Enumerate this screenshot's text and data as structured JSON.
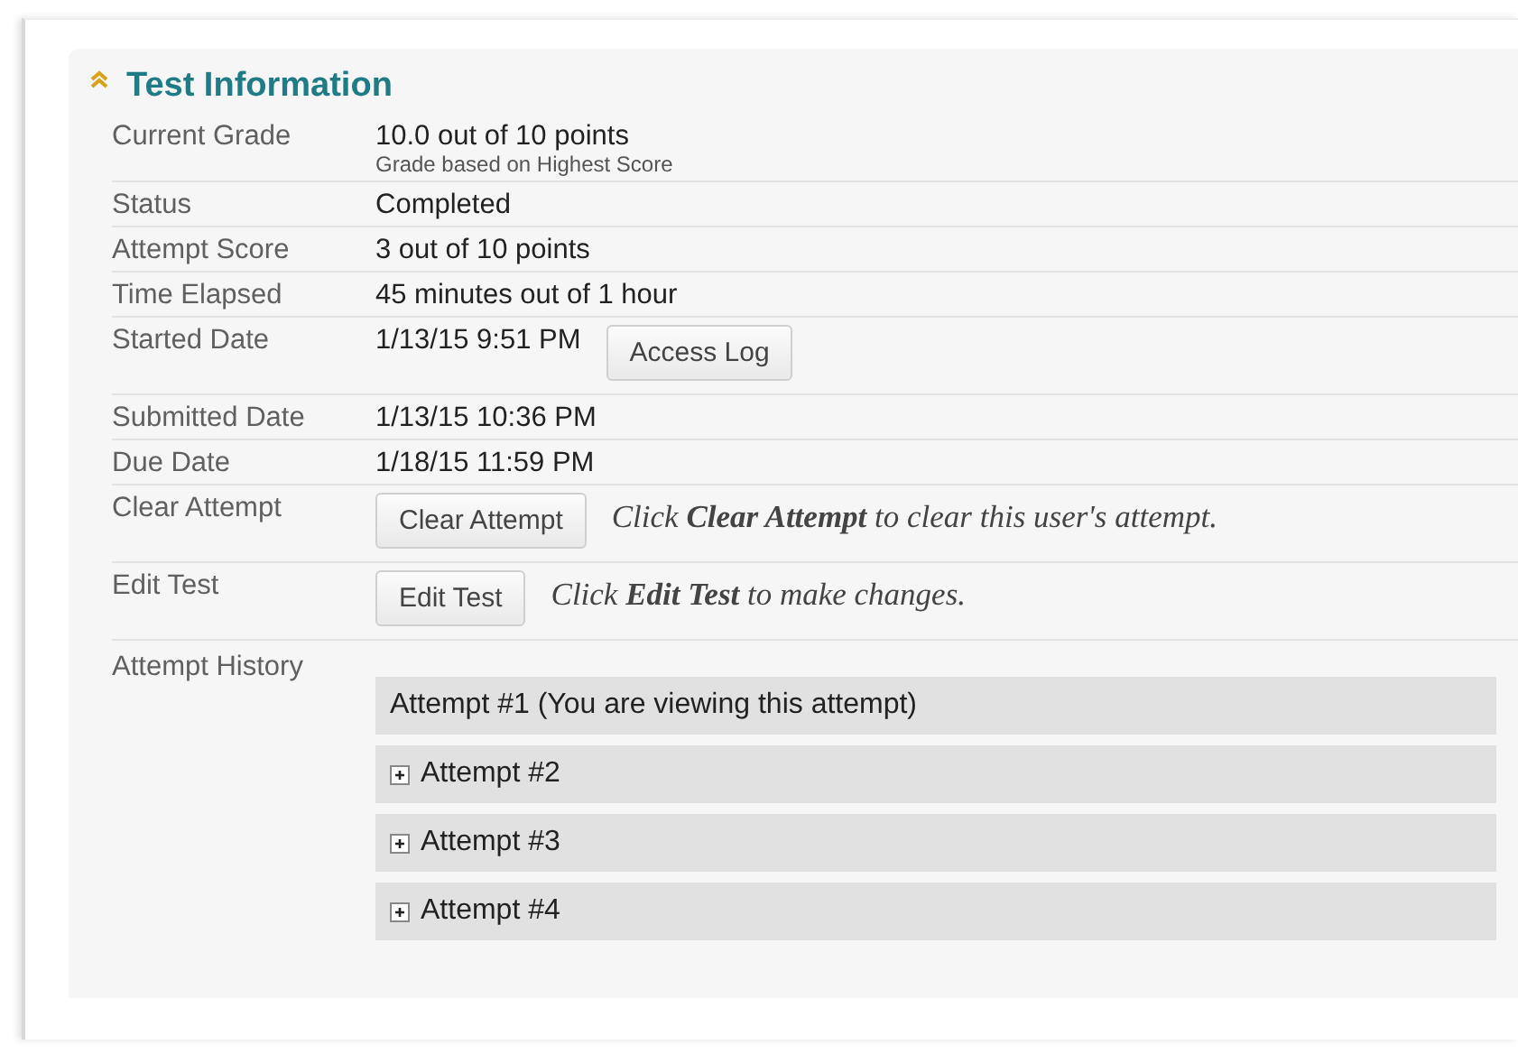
{
  "panel": {
    "title": "Test Information",
    "collapsed": false
  },
  "rows": [
    {
      "label": "Current Grade",
      "value": "10.0 out of 10 points",
      "subtext": "Grade based on Highest Score"
    },
    {
      "label": "Status",
      "value": "Completed"
    },
    {
      "label": "Attempt Score",
      "value": "3 out of 10 points"
    },
    {
      "label": "Time Elapsed",
      "value": "45 minutes out of 1 hour"
    },
    {
      "label": "Started Date",
      "value": "1/13/15 9:51 PM",
      "button": "Access Log"
    },
    {
      "label": "Submitted Date",
      "value": "1/13/15 10:36 PM"
    },
    {
      "label": "Due Date",
      "value": "1/18/15 11:59 PM"
    },
    {
      "label": "Clear Attempt",
      "button": "Clear Attempt",
      "note": "Click **Clear Attempt** to clear this user's attempt."
    },
    {
      "label": "Edit Test",
      "button": "Edit Test",
      "note": "Click **Edit Test** to make changes."
    }
  ],
  "attempt_history": {
    "label": "Attempt History",
    "attempts": [
      {
        "title": "Attempt #1 (You are viewing this attempt)",
        "expandable": false
      },
      {
        "title": "Attempt #2",
        "expandable": true
      },
      {
        "title": "Attempt #3",
        "expandable": true
      },
      {
        "title": "Attempt #4",
        "expandable": true
      }
    ]
  }
}
